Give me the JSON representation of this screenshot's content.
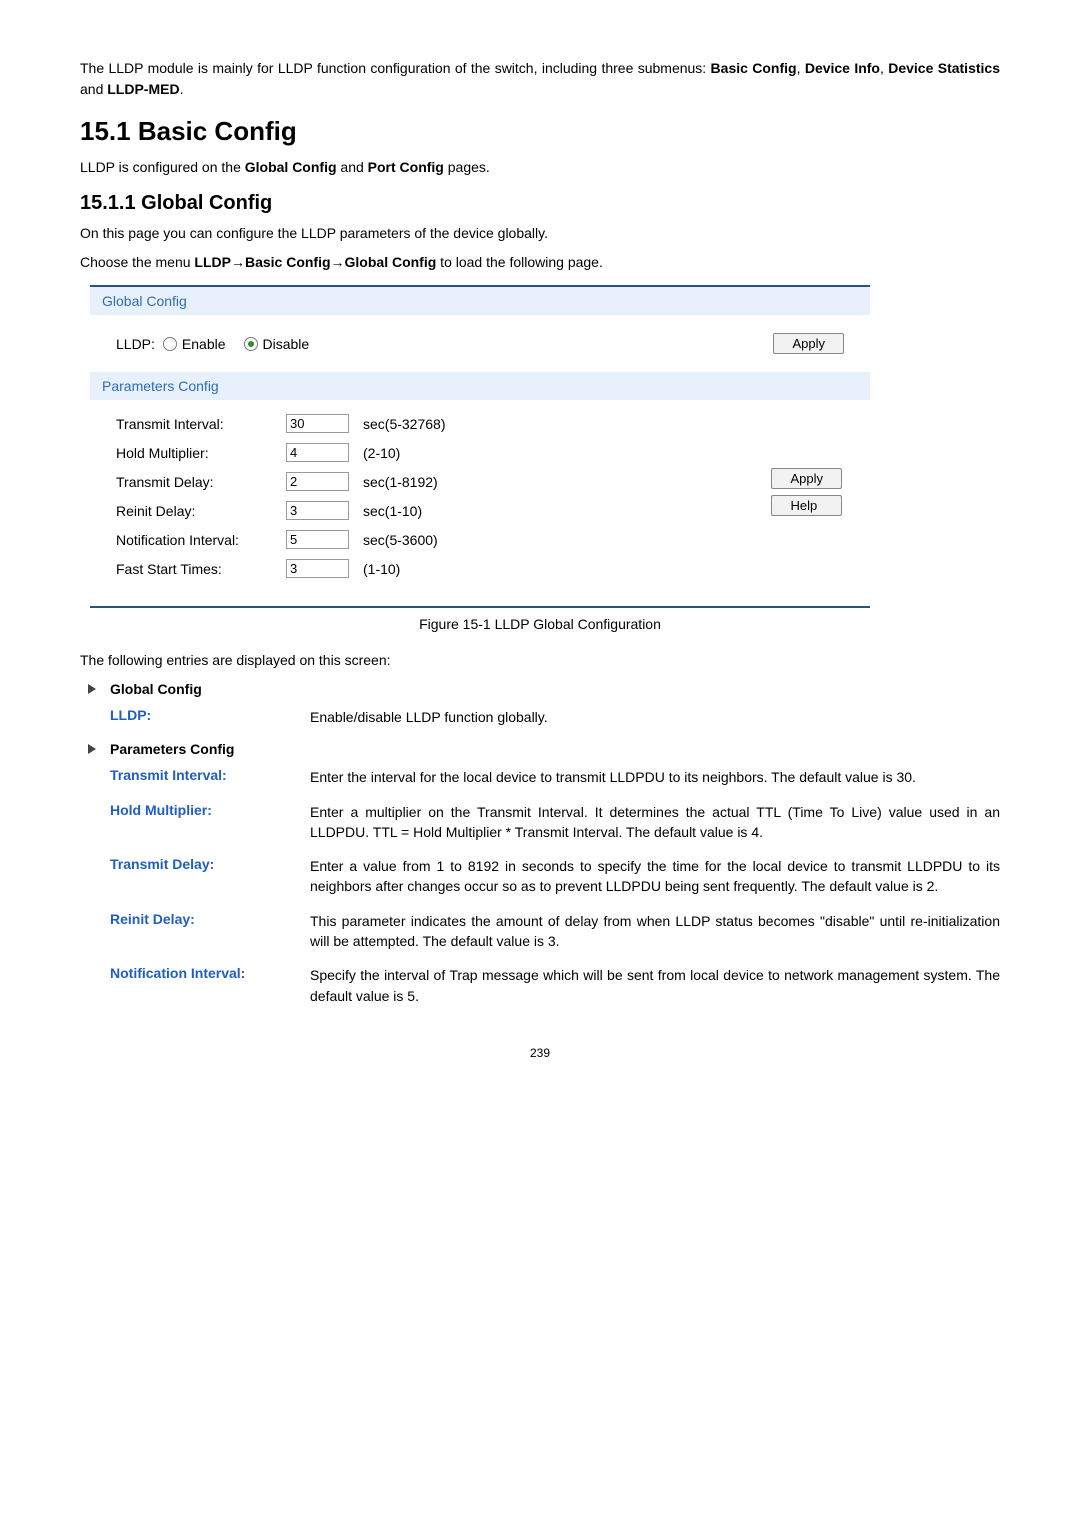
{
  "intro": {
    "text_before": "The LLDP module is mainly for LLDP function configuration of the switch, including three submenus: ",
    "bold_list": "Basic Config, Device Info, Device Statistics",
    "and_word": " and ",
    "last_bold": "LLDP-MED",
    "period": "."
  },
  "h1": "15.1 Basic Config",
  "h1_sub_before": "LLDP is configured on the ",
  "h1_sub_b1": "Global Config",
  "h1_sub_mid": " and ",
  "h1_sub_b2": "Port Config",
  "h1_sub_after": " pages.",
  "h2": "15.1.1  Global Config",
  "h2_p1": "On this page you can configure the LLDP parameters of the device globally.",
  "h2_p2_before": "Choose the menu ",
  "h2_p2_bold": "LLDP→Basic Config→Global Config",
  "h2_p2_after": " to load the following page.",
  "global_config": {
    "header": "Global Config",
    "lldp_label": "LLDP:",
    "enable_label": "Enable",
    "disable_label": "Disable",
    "apply": "Apply"
  },
  "params_config": {
    "header": "Parameters Config",
    "rows": [
      {
        "label": "Transmit Interval:",
        "value": "30",
        "hint": "sec(5-32768)"
      },
      {
        "label": "Hold Multiplier:",
        "value": "4",
        "hint": "(2-10)"
      },
      {
        "label": "Transmit Delay:",
        "value": "2",
        "hint": "sec(1-8192)"
      },
      {
        "label": "Reinit Delay:",
        "value": "3",
        "hint": "sec(1-10)"
      },
      {
        "label": "Notification Interval:",
        "value": "5",
        "hint": "sec(5-3600)"
      },
      {
        "label": "Fast Start Times:",
        "value": "3",
        "hint": "(1-10)"
      }
    ],
    "apply": "Apply",
    "help": "Help"
  },
  "caption": "Figure 15-1 LLDP Global Configuration",
  "entries_intro": "The following entries are displayed on this screen:",
  "section_gc": "Global Config",
  "gc_term": "LLDP:",
  "gc_def": "Enable/disable LLDP function globally.",
  "section_pc": "Parameters Config",
  "pc_terms": [
    {
      "term": "Transmit Interval:",
      "def": "Enter the interval for the local device to transmit LLDPDU to its neighbors. The default value is 30."
    },
    {
      "term": "Hold Multiplier:",
      "def": "Enter a multiplier on the Transmit Interval. It determines the actual TTL (Time To Live) value used in an LLDPDU. TTL = Hold Multiplier * Transmit Interval. The default value is 4."
    },
    {
      "term": "Transmit Delay:",
      "def": "Enter a value from 1 to 8192 in seconds to specify the time for the local device to transmit LLDPDU to its neighbors after changes occur so as to prevent LLDPDU being sent frequently. The default value is 2."
    },
    {
      "term": "Reinit Delay:",
      "def": "This parameter indicates the amount of delay from when LLDP status becomes \"disable\" until re-initialization will be attempted. The default value is 3."
    },
    {
      "term": "Notification Interval:",
      "def": "Specify the interval of Trap message which will be sent from local device to network management system. The default value is 5."
    }
  ],
  "page_num": "239"
}
